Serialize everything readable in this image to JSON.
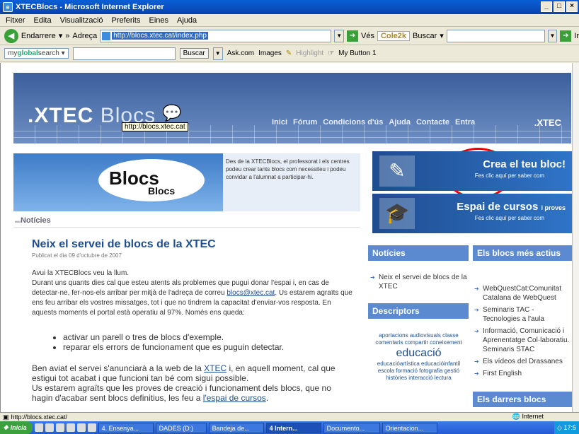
{
  "window": {
    "title": "XTECBlocs - Microsoft Internet Explorer",
    "controls": [
      "_",
      "□",
      "×"
    ]
  },
  "menu": [
    "Fitxer",
    "Edita",
    "Visualització",
    "Preferits",
    "Eines",
    "Ajuda"
  ],
  "toolbar": {
    "back_label": "Endarrere",
    "address_label": "Adreça",
    "address_value": "http://blocs.xtec.cat/index.php",
    "go_label": "Vés",
    "cole_label": "Cole2k",
    "search_label": "Buscar",
    "ir_label": "Ir"
  },
  "toolbar2": {
    "brand_prefix": "my",
    "brand_mid": "global",
    "brand_suffix": "search",
    "buscar_label": "Buscar",
    "ask_label": "Ask.com",
    "images_label": "Images",
    "highlight_label": "Highlight",
    "mybutton_label": "My Button 1"
  },
  "banner": {
    "logo_main": ".XTEC",
    "logo_blocs": "Blocs",
    "nav": [
      "Inici",
      "Fórum",
      "Condicions d'ús",
      "Ajuda",
      "Contacte",
      "Entra"
    ],
    "brand": ".XTEC",
    "tooltip": "http://blocs.xtec.cat"
  },
  "intro": {
    "word1": "Blocs",
    "word2": "Blocs",
    "text": "Des de la XTECBlocs, el professorat i els centres podeu crear tants blocs com necessiteu i podeu convidar a l'alumnat a participar-hi."
  },
  "section_label": "Notícies",
  "article": {
    "title": "Neix el servei de blocs de la XTEC",
    "date": "Publicat el dia 09 d'octubre de 2007",
    "p1_a": "Avui la XTECBlocs veu la llum.",
    "p1_b": "Durant uns quants dies cal que esteu atents als problemes que pugui donar l'espai i, en cas de detectar-ne, fer-nos-els arribar per mitjà de l'adreça de correu ",
    "p1_link": "blocs@xtec.cat",
    "p1_c": ". Us estarem agraïts que ens feu arribar els vostres missatges, tot i que no tindrem la capacitat d'enviar-vos resposta. En aquests moments el portal està operatiu al 97%. Només ens queda:",
    "bullets": [
      "activar un parell o tres de blocs d'exemple.",
      "reparar els errors de funcionament que es puguin detectar."
    ],
    "p2_a": "Ben aviat el servei s'anunciarà a la web de la ",
    "p2_link": "XTEC",
    "p2_b": " i, en aquell moment, cal que estigui tot acabat i que funcioni tan bé com sigui possible.",
    "p3_a": "Us estarem agraïts que les proves de creació i funcionament dels blocs, que no hagin d'acabar sent blocs definitius, les feu a ",
    "p3_link": "l'espai de cursos",
    "p3_b": "."
  },
  "promos": [
    {
      "title": "Crea el teu bloc!",
      "extra": "",
      "sub": "Fes clic aquí per saber com"
    },
    {
      "title": "Espai de cursos",
      "extra": "i proves",
      "sub": "Fes clic aquí per saber com"
    }
  ],
  "noticies_col": {
    "heading": "Notícies",
    "items": [
      "Neix el servei de blocs de la XTEC"
    ]
  },
  "descriptors": {
    "heading": "Descriptors",
    "tags_a": "aportacions audiovisuals classe comentaris compartir coneixement",
    "tag_big": "educació",
    "tags_b": "educacióartística educacióinfantil escola formació fotografia gestió històries interacció lectura"
  },
  "mes_actius": {
    "heading": "Els blocs més actius",
    "items": [
      "WebQuestCat:Comunitat Catalana de WebQuest",
      "Seminaris TAC - Tecnologies a l'aula",
      "Informació, Comunicació i Aprenentatge Col·laboratiu. Seminaris STAC",
      "Els vídeos del Drassanes",
      "First English"
    ]
  },
  "darrers": {
    "heading": "Els darrers blocs"
  },
  "status": {
    "url": "http://blocs.xtec.cat/",
    "zone": "Internet"
  },
  "taskbar": {
    "start": "Inicia",
    "tasks": [
      "4. Ensenya...",
      "DADES (D:)",
      "Bandeja de...",
      "4 Intern...",
      "Documento...",
      "Orientacion..."
    ],
    "clock": "17:5"
  }
}
